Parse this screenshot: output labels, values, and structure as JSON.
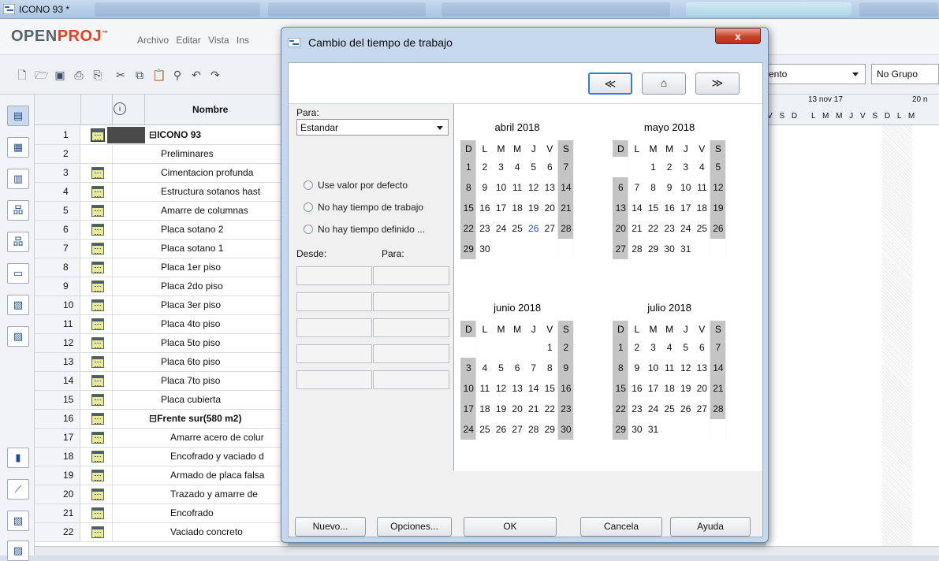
{
  "window": {
    "title": "ICONO 93 *",
    "menus": [
      "Archivo",
      "Editar",
      "Vista",
      "Ins"
    ],
    "logo_open": "OPEN",
    "logo_proj": "PROJ"
  },
  "toolbar": {
    "combo_view": "ento",
    "combo_group": "No Grupo"
  },
  "grid": {
    "header_name": "Nombre",
    "header_info": "i",
    "rows": [
      {
        "n": "1",
        "name": "ICONO 93",
        "bold": true,
        "icon": true,
        "expand": "⊟"
      },
      {
        "n": "2",
        "name": "Preliminares",
        "icon": false
      },
      {
        "n": "3",
        "name": "Cimentacion profunda",
        "icon": true
      },
      {
        "n": "4",
        "name": "Estructura sotanos hast",
        "icon": true
      },
      {
        "n": "5",
        "name": "Amarre de columnas",
        "icon": true
      },
      {
        "n": "6",
        "name": "Placa sotano 2",
        "icon": true
      },
      {
        "n": "7",
        "name": "Placa sotano 1",
        "icon": true
      },
      {
        "n": "8",
        "name": "Placa 1er piso",
        "icon": true
      },
      {
        "n": "9",
        "name": "Placa 2do piso",
        "icon": true
      },
      {
        "n": "10",
        "name": "Placa 3er piso",
        "icon": true
      },
      {
        "n": "11",
        "name": "Placa 4to piso",
        "icon": true
      },
      {
        "n": "12",
        "name": "Placa 5to piso",
        "icon": true
      },
      {
        "n": "13",
        "name": "Placa 6to piso",
        "icon": true
      },
      {
        "n": "14",
        "name": "Placa 7to piso",
        "icon": true
      },
      {
        "n": "15",
        "name": "Placa cubierta",
        "icon": true
      },
      {
        "n": "16",
        "name": "Frente sur(580 m2)",
        "bold": true,
        "icon": true,
        "expand": "⊟"
      },
      {
        "n": "17",
        "name": "Amarre acero de colur",
        "icon": true,
        "indent": true
      },
      {
        "n": "18",
        "name": "Encofrado y vaciado d",
        "icon": true,
        "indent": true
      },
      {
        "n": "19",
        "name": "Armado de placa falsa",
        "icon": true,
        "indent": true
      },
      {
        "n": "20",
        "name": "Trazado y amarre de",
        "icon": true,
        "indent": true
      },
      {
        "n": "21",
        "name": "Encofrado",
        "icon": true,
        "indent": true
      },
      {
        "n": "22",
        "name": "Vaciado concreto",
        "icon": true,
        "indent": true
      }
    ]
  },
  "gantt": {
    "week1": "13 nov 17",
    "week2": "20 n",
    "days_prefix": "V S D",
    "days": "L M M J V S D L M"
  },
  "dialog": {
    "title": "Cambio del tiempo de trabajo",
    "close": "x",
    "nav_prev": "≪",
    "nav_home": "⌂",
    "nav_next": "≫",
    "para_label": "Para:",
    "para_value": "Estandar",
    "radios": [
      "Use valor por defecto",
      "No hay tiempo de trabajo",
      "No hay tiempo definido ..."
    ],
    "desde_label": "Desde:",
    "para2_label": "Para:",
    "buttons": [
      "Nuevo...",
      "Opciones...",
      "OK",
      "Cancela",
      "Ayuda"
    ],
    "dow": [
      "D",
      "L",
      "M",
      "M",
      "J",
      "V",
      "S"
    ],
    "months": [
      {
        "title": "abril 2018",
        "weeks": [
          [
            "1",
            "2",
            "3",
            "4",
            "5",
            "6",
            "7"
          ],
          [
            "8",
            "9",
            "10",
            "11",
            "12",
            "13",
            "14"
          ],
          [
            "15",
            "16",
            "17",
            "18",
            "19",
            "20",
            "21"
          ],
          [
            "22",
            "23",
            "24",
            "25",
            "26",
            "27",
            "28"
          ],
          [
            "29",
            "30",
            "",
            "",
            "",
            "",
            ""
          ]
        ],
        "highlight": "26"
      },
      {
        "title": "mayo 2018",
        "weeks": [
          [
            "",
            "",
            "1",
            "2",
            "3",
            "4",
            "5"
          ],
          [
            "6",
            "7",
            "8",
            "9",
            "10",
            "11",
            "12"
          ],
          [
            "13",
            "14",
            "15",
            "16",
            "17",
            "18",
            "19"
          ],
          [
            "20",
            "21",
            "22",
            "23",
            "24",
            "25",
            "26"
          ],
          [
            "27",
            "28",
            "29",
            "30",
            "31",
            "",
            ""
          ]
        ]
      },
      {
        "title": "junio 2018",
        "weeks": [
          [
            "",
            "",
            "",
            "",
            "",
            "1",
            "2"
          ],
          [
            "3",
            "4",
            "5",
            "6",
            "7",
            "8",
            "9"
          ],
          [
            "10",
            "11",
            "12",
            "13",
            "14",
            "15",
            "16"
          ],
          [
            "17",
            "18",
            "19",
            "20",
            "21",
            "22",
            "23"
          ],
          [
            "24",
            "25",
            "26",
            "27",
            "28",
            "29",
            "30"
          ]
        ]
      },
      {
        "title": "julio 2018",
        "weeks": [
          [
            "1",
            "2",
            "3",
            "4",
            "5",
            "6",
            "7"
          ],
          [
            "8",
            "9",
            "10",
            "11",
            "12",
            "13",
            "14"
          ],
          [
            "15",
            "16",
            "17",
            "18",
            "19",
            "20",
            "21"
          ],
          [
            "22",
            "23",
            "24",
            "25",
            "26",
            "27",
            "28"
          ],
          [
            "29",
            "30",
            "31",
            "",
            "",
            "",
            ""
          ]
        ]
      }
    ]
  },
  "colors": {
    "accent_highlight": "#1f4fb8",
    "weekend_shade": "#c4c4c4"
  }
}
